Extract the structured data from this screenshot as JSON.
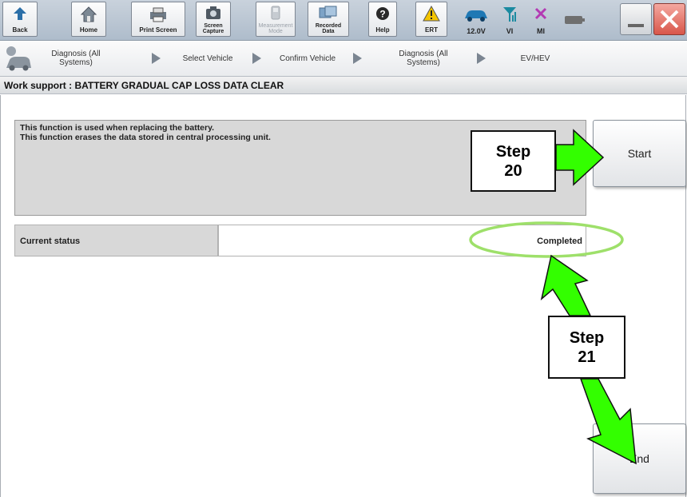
{
  "toolbar": {
    "back": "Back",
    "home": "Home",
    "print_screen": "Print Screen",
    "screen_capture": "Screen\nCapture",
    "measurement_mode": "Measurement\nMode",
    "recorded_data": "Recorded\nData",
    "help": "Help",
    "ert": "ERT",
    "voltage": "12.0V",
    "vi": "VI",
    "mi": "MI"
  },
  "breadcrumb": {
    "items": [
      "Diagnosis (All\nSystems)",
      "Select Vehicle",
      "Confirm Vehicle",
      "Diagnosis (All\nSystems)",
      "EV/HEV"
    ]
  },
  "page": {
    "title": "Work support : BATTERY GRADUAL CAP LOSS DATA CLEAR",
    "description_line1": "This function is used when replacing the battery.",
    "description_line2": "This function erases the data stored in central processing unit.",
    "start_label": "Start",
    "end_label": "End",
    "status_label": "Current status",
    "status_value": "Completed"
  },
  "callouts": {
    "step20": "Step\n20",
    "step21": "Step\n21"
  },
  "colors": {
    "arrow_green": "#33ff00",
    "highlight_ellipse": "#9ee06a",
    "close_red": "#d8564a"
  }
}
